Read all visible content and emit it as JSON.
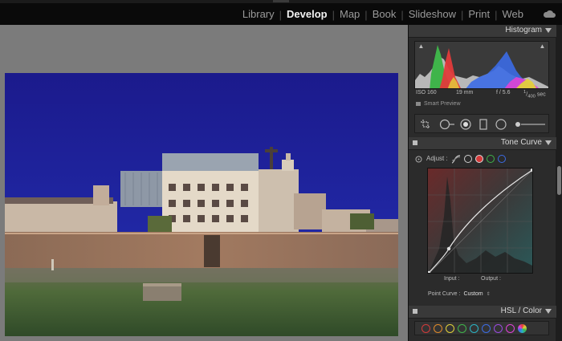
{
  "modules": {
    "items": [
      "Library",
      "Develop",
      "Map",
      "Book",
      "Slideshow",
      "Print",
      "Web"
    ],
    "active": "Develop"
  },
  "histogram": {
    "title": "Histogram",
    "iso": "ISO 160",
    "focal": "19 mm",
    "aperture": "f / 5.6",
    "shutter_num": "1",
    "shutter_den": "400",
    "shutter_unit": "sec",
    "smart_preview": "Smart Preview"
  },
  "tone_curve": {
    "title": "Tone Curve",
    "adjust_label": "Adjust :",
    "input_label": "Input :",
    "output_label": "Output :",
    "point_curve_label": "Point Curve :",
    "point_curve_value": "Custom"
  },
  "hsl": {
    "title": "HSL / Color"
  },
  "icons": {
    "cloud": "cloud-icon",
    "crop": "crop-icon",
    "spot_removal": "spot-removal-icon",
    "red_eye": "red-eye-icon",
    "graduated_filter": "graduated-filter-icon",
    "radial_filter": "radial-filter-icon",
    "brush": "adjustment-brush-icon"
  },
  "colors": {
    "accent_text": "#f2f2f2",
    "panel_bg": "#2b2b2b",
    "sky": "#1c1d96"
  }
}
